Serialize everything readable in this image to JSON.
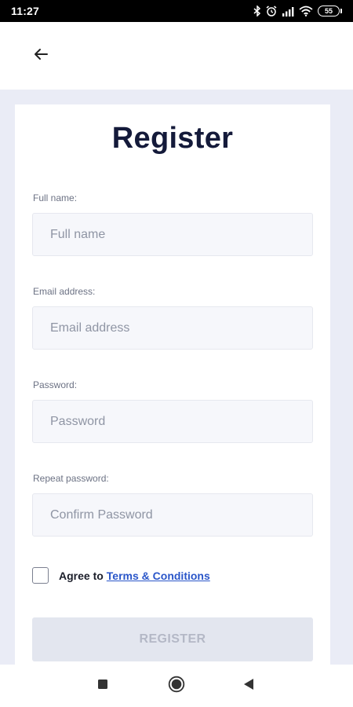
{
  "status_bar": {
    "time": "11:27",
    "battery": "55",
    "icons": [
      "bluetooth-icon",
      "alarm-icon",
      "signal-icon",
      "wifi-icon",
      "battery-icon"
    ]
  },
  "header": {
    "back_icon": "arrow-left-icon"
  },
  "form": {
    "title": "Register",
    "fields": [
      {
        "label": "Full name:",
        "placeholder": "Full name",
        "value": ""
      },
      {
        "label": "Email address:",
        "placeholder": "Email address",
        "value": ""
      },
      {
        "label": "Password:",
        "placeholder": "Password",
        "value": ""
      },
      {
        "label": "Repeat password:",
        "placeholder": "Confirm Password",
        "value": ""
      }
    ],
    "agree_text": "Agree to",
    "terms_link": "Terms & Conditions",
    "terms_checked": false,
    "submit_label": "REGISTER"
  },
  "nav_bar": {
    "buttons": [
      "recents-square-icon",
      "home-circle-icon",
      "back-triangle-icon"
    ]
  },
  "colors": {
    "title": "#141a3a",
    "link": "#2a56c9",
    "page_background": "#eaecf6",
    "input_background": "#f6f7fb",
    "button_disabled": "#e3e6ef"
  }
}
